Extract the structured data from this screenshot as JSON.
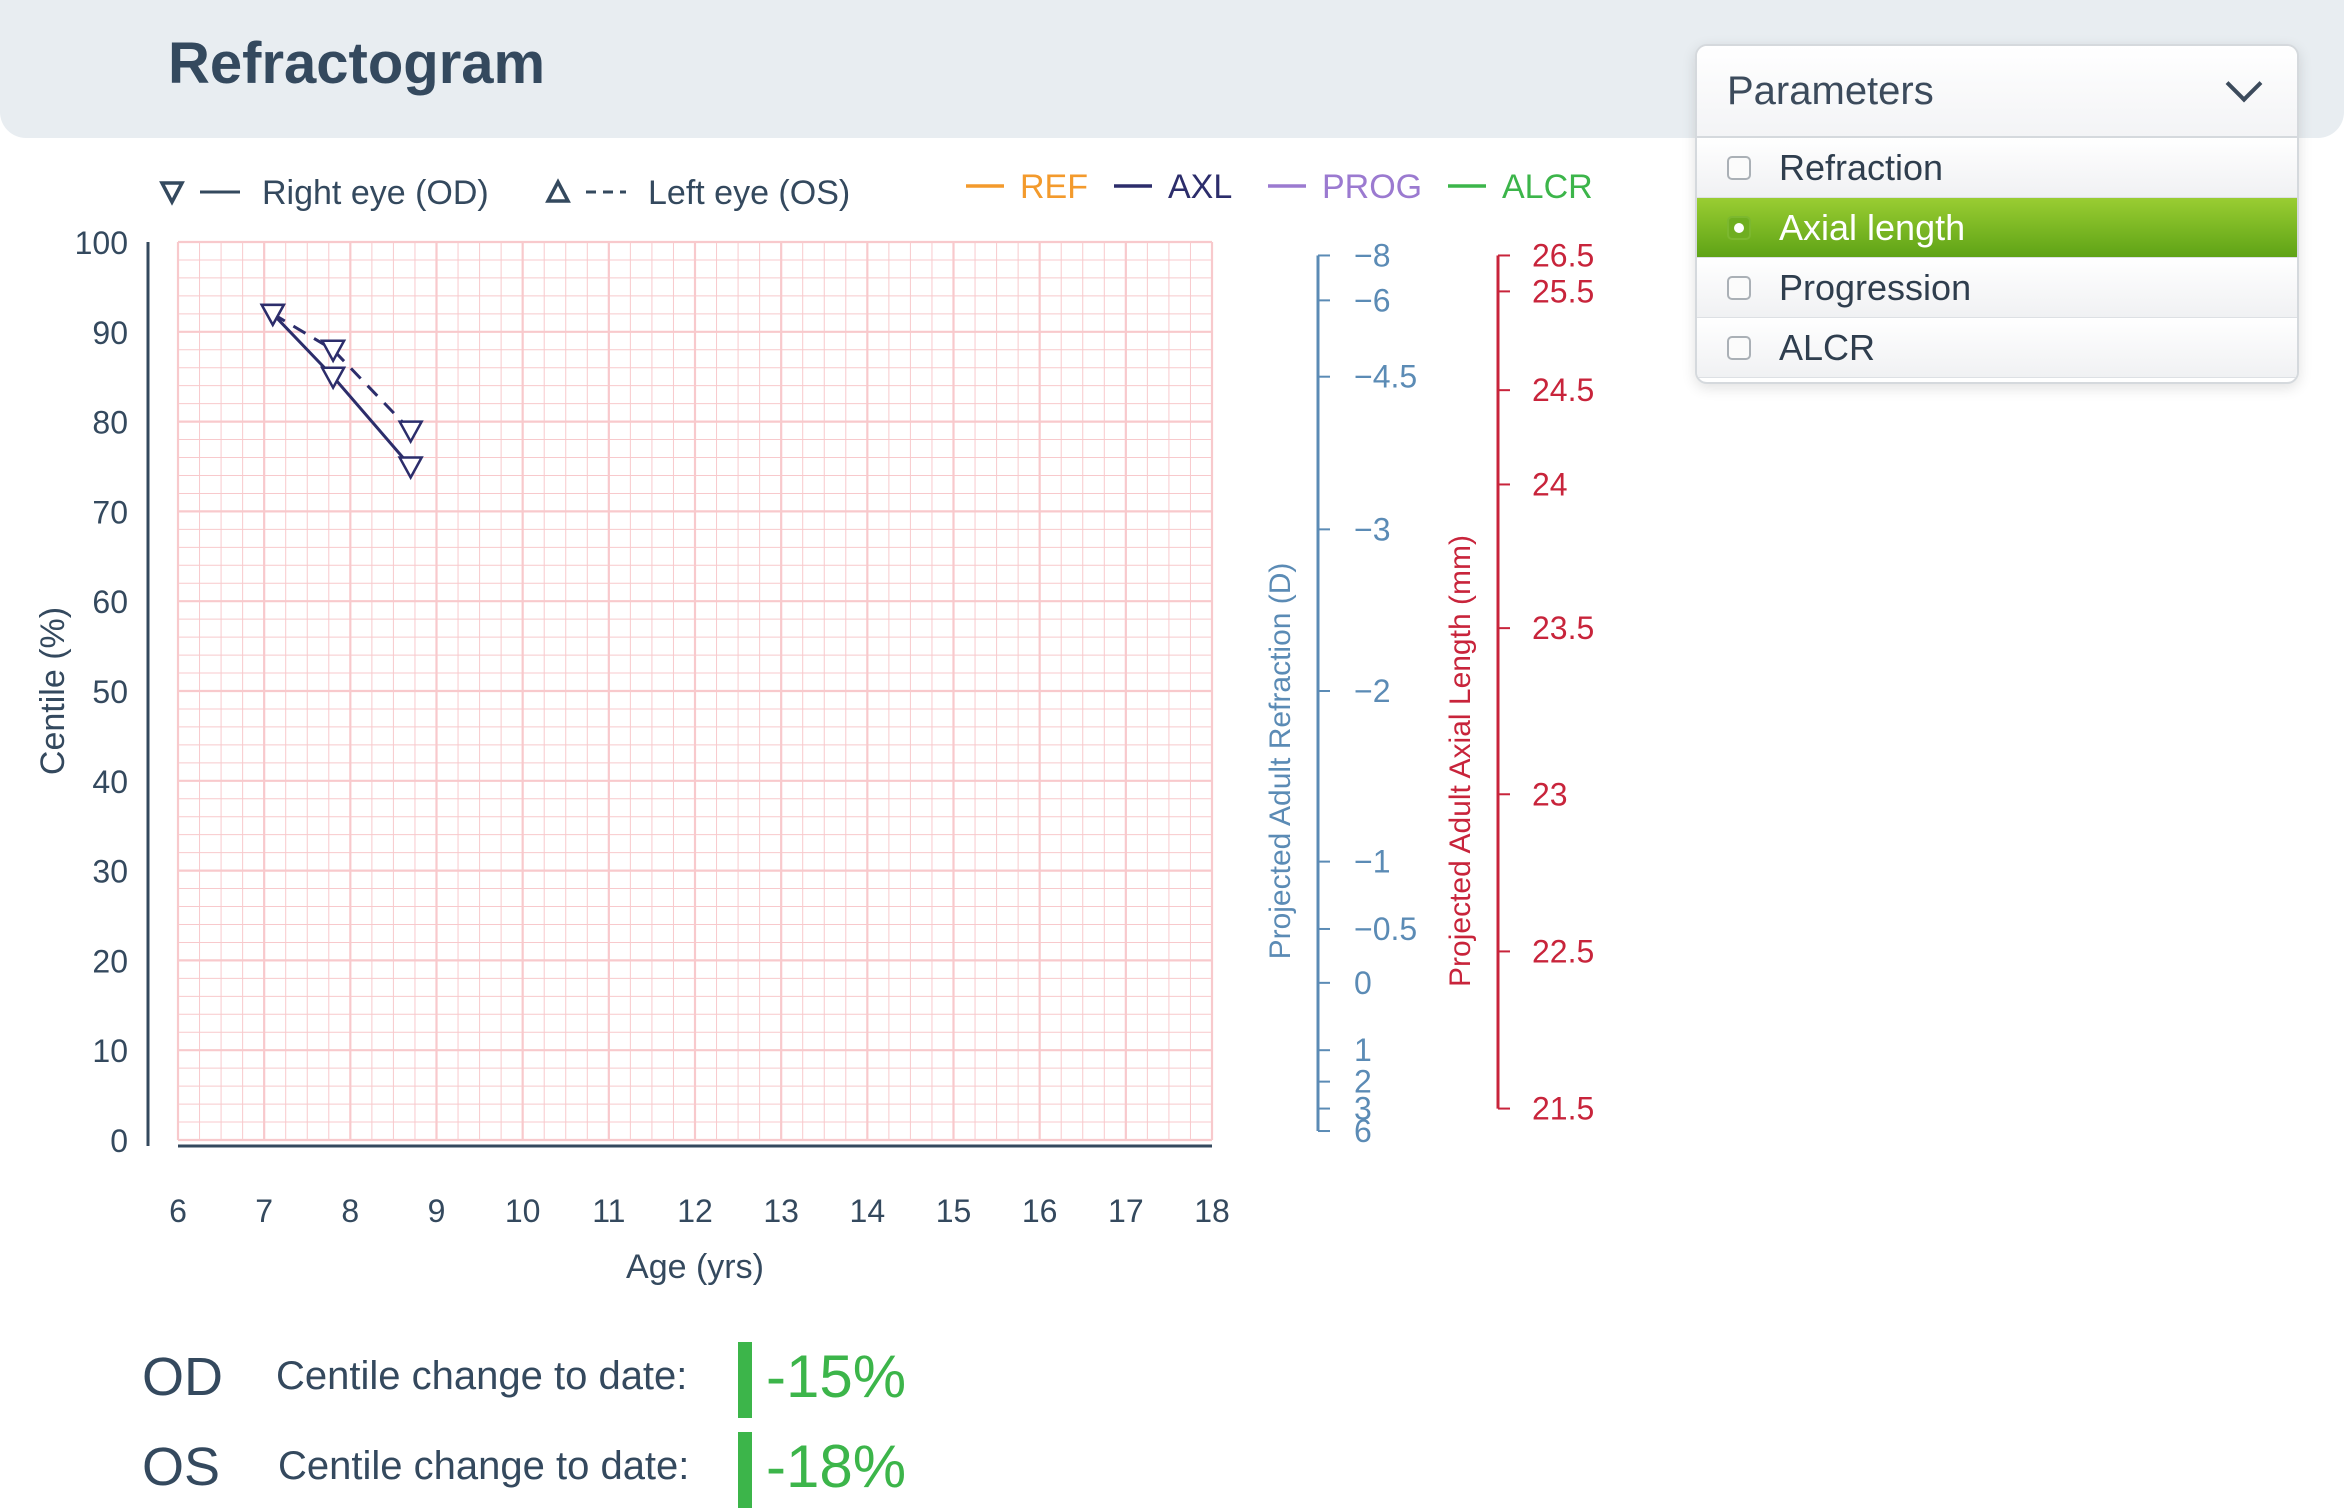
{
  "page": {
    "title": "Refractogram"
  },
  "parameters": {
    "title": "Parameters",
    "options": [
      {
        "label": "Refraction",
        "selected": false
      },
      {
        "label": "Axial length",
        "selected": true
      },
      {
        "label": "Progression",
        "selected": false
      },
      {
        "label": "ALCR",
        "selected": false
      }
    ]
  },
  "colors": {
    "ref": "#f39a2c",
    "axl": "#2c2d6b",
    "prog": "#9b7ad0",
    "alcr": "#3cb54a",
    "refraction_axis": "#5b8bb5",
    "axial_axis": "#c8243b",
    "grid": "#f8c9cc"
  },
  "summary": [
    {
      "eye": "OD",
      "label": "Centile change to date:",
      "value": "-15%"
    },
    {
      "eye": "OS",
      "label": "Centile change to date:",
      "value": "-18%"
    }
  ],
  "chart_data": {
    "type": "line",
    "title": "",
    "xlabel": "Age (yrs)",
    "ylabel": "Centile (%)",
    "xlim": [
      6,
      18
    ],
    "ylim": [
      0,
      100
    ],
    "xticks": [
      "6",
      "7",
      "8",
      "9",
      "10",
      "11",
      "12",
      "13",
      "14",
      "15",
      "16",
      "17",
      "18"
    ],
    "yticks": [
      "0",
      "10",
      "20",
      "30",
      "40",
      "50",
      "60",
      "70",
      "80",
      "90",
      "100"
    ],
    "grid": true,
    "eye_legend": [
      {
        "label": "Right eye (OD)",
        "marker": "down-triangle",
        "line": "solid"
      },
      {
        "label": "Left eye (OS)",
        "marker": "up-triangle",
        "line": "dashed"
      }
    ],
    "param_legend": [
      {
        "label": "REF",
        "color": "#f39a2c"
      },
      {
        "label": "AXL",
        "color": "#2c2d6b"
      },
      {
        "label": "PROG",
        "color": "#9b7ad0"
      },
      {
        "label": "ALCR",
        "color": "#3cb54a"
      }
    ],
    "series": [
      {
        "x": [
          7.1,
          7.8,
          8.7
        ],
        "y": [
          92,
          85,
          75
        ],
        "color": "#2c2d6b",
        "dash": "solid",
        "marker": "down-triangle"
      },
      {
        "x": [
          7.1,
          7.8,
          8.7
        ],
        "y": [
          92,
          88,
          79
        ],
        "color": "#2c2d6b",
        "dash": "dashed",
        "marker": "down-triangle"
      }
    ],
    "refraction_axis": {
      "label": "Projected Adult Refraction (D)",
      "ticks": [
        {
          "label": "−8",
          "centile": 98.5
        },
        {
          "label": "−6",
          "centile": 93.5
        },
        {
          "label": "−4.5",
          "centile": 85
        },
        {
          "label": "−3",
          "centile": 68
        },
        {
          "label": "−2",
          "centile": 50
        },
        {
          "label": "−1",
          "centile": 31
        },
        {
          "label": "−0.5",
          "centile": 23.5
        },
        {
          "label": "0",
          "centile": 17.5
        },
        {
          "label": "1",
          "centile": 10
        },
        {
          "label": "2",
          "centile": 6.5
        },
        {
          "label": "3",
          "centile": 3.5
        },
        {
          "label": "6",
          "centile": 1
        }
      ]
    },
    "axial_axis": {
      "label": "Projected Adult Axial Length (mm)",
      "ticks": [
        {
          "label": "26.5",
          "centile": 98.5
        },
        {
          "label": "25.5",
          "centile": 94.5
        },
        {
          "label": "24.5",
          "centile": 83.5
        },
        {
          "label": "24",
          "centile": 73
        },
        {
          "label": "23.5",
          "centile": 57
        },
        {
          "label": "23",
          "centile": 38.5
        },
        {
          "label": "22.5",
          "centile": 21
        },
        {
          "label": "21.5",
          "centile": 3.5
        }
      ]
    }
  }
}
